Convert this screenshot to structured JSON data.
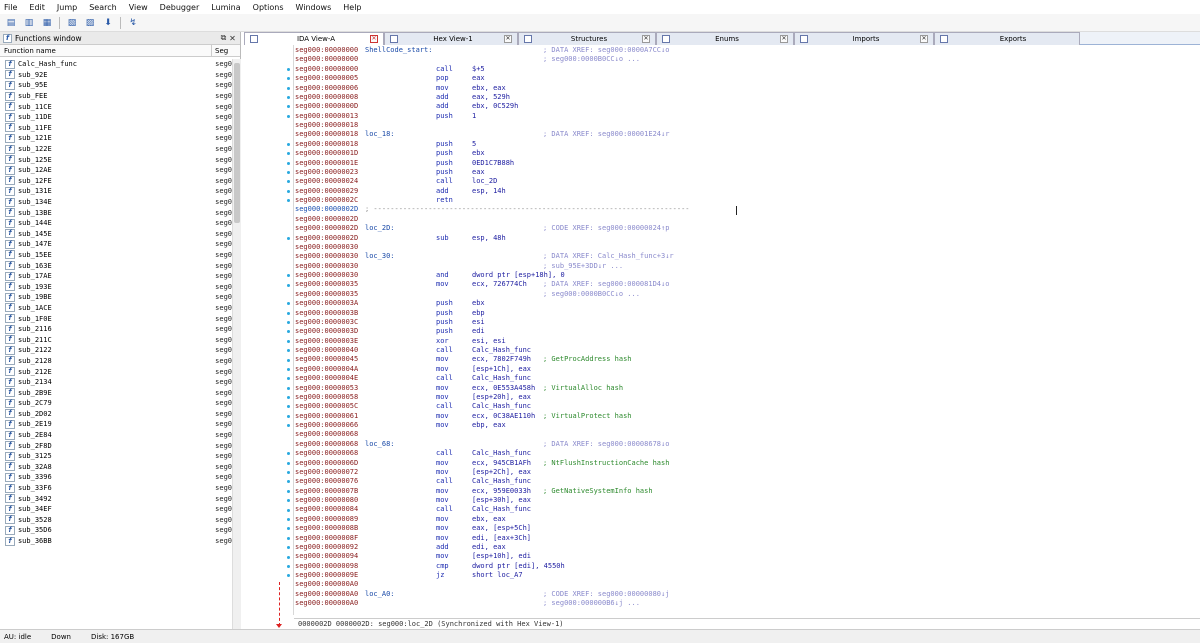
{
  "menu": [
    "File",
    "Edit",
    "Jump",
    "Search",
    "View",
    "Debugger",
    "Lumina",
    "Options",
    "Windows",
    "Help"
  ],
  "functions_window": {
    "title": "Functions window",
    "col_name": "Function name",
    "col_seg": "Seg",
    "functions": [
      "Calc_Hash_func",
      "sub_92E",
      "sub_95E",
      "sub_FEE",
      "sub_11CE",
      "sub_11DE",
      "sub_11FE",
      "sub_121E",
      "sub_122E",
      "sub_125E",
      "sub_12AE",
      "sub_12FE",
      "sub_131E",
      "sub_134E",
      "sub_13BE",
      "sub_144E",
      "sub_145E",
      "sub_147E",
      "sub_15EE",
      "sub_163E",
      "sub_17AE",
      "sub_193E",
      "sub_19BE",
      "sub_1ACE",
      "sub_1F0E",
      "sub_2116",
      "sub_211C",
      "sub_2122",
      "sub_2128",
      "sub_212E",
      "sub_2134",
      "sub_2B9E",
      "sub_2C79",
      "sub_2D02",
      "sub_2E19",
      "sub_2E84",
      "sub_2F8D",
      "sub_3125",
      "sub_32A8",
      "sub_3396",
      "sub_33F6",
      "sub_3492",
      "sub_34EF",
      "sub_3528",
      "sub_35D6",
      "sub_36BB"
    ],
    "seg_value": "seg0"
  },
  "tabs": [
    {
      "label": "IDA View-A",
      "active": true
    },
    {
      "label": "Hex View-1",
      "active": false
    },
    {
      "label": "Structures",
      "active": false
    },
    {
      "label": "Enums",
      "active": false
    },
    {
      "label": "Imports",
      "active": false
    },
    {
      "label": "Exports",
      "active": false
    }
  ],
  "disasm": [
    {
      "a": "seg000:00000000",
      "l": "ShellCode_start:",
      "x": "; DATA XREF: seg000:0000A7CC↓o"
    },
    {
      "a": "seg000:00000000",
      "x": "; seg000:0000B0CC↓o ..."
    },
    {
      "a": "seg000:00000000",
      "m": "call",
      "o": "$+5",
      "d": 1
    },
    {
      "a": "seg000:00000005",
      "m": "pop",
      "o": "eax",
      "d": 1
    },
    {
      "a": "seg000:00000006",
      "m": "mov",
      "o": "ebx, eax",
      "d": 1
    },
    {
      "a": "seg000:00000008",
      "m": "add",
      "o": "eax, 529h",
      "d": 1
    },
    {
      "a": "seg000:0000000D",
      "m": "add",
      "o": "ebx, 0C529h",
      "d": 1
    },
    {
      "a": "seg000:00000013",
      "m": "push",
      "o": "1",
      "d": 1
    },
    {
      "a": "seg000:00000018"
    },
    {
      "a": "seg000:00000018",
      "l": "loc_18:",
      "x": "; DATA XREF: seg000:00001E24↓r"
    },
    {
      "a": "seg000:00000018",
      "m": "push",
      "o": "5",
      "d": 1
    },
    {
      "a": "seg000:0000001D",
      "m": "push",
      "o": "ebx",
      "d": 1
    },
    {
      "a": "seg000:0000001E",
      "m": "push",
      "o": "0ED1C7B88h",
      "d": 1
    },
    {
      "a": "seg000:00000023",
      "m": "push",
      "o": "eax",
      "d": 1
    },
    {
      "a": "seg000:00000024",
      "m": "call",
      "o": "loc_2D",
      "d": 1
    },
    {
      "a": "seg000:00000029",
      "m": "add",
      "o": "esp, 14h",
      "d": 1
    },
    {
      "a": "seg000:0000002C",
      "m": "retn",
      "d": 1
    },
    {
      "a": "seg000:0000002D",
      "sep": "; ---------------------------------------------------------------------------",
      "hl": 1
    },
    {
      "a": "seg000:0000002D"
    },
    {
      "a": "seg000:0000002D",
      "l": "loc_2D:",
      "x": "; CODE XREF: seg000:00000024↑p"
    },
    {
      "a": "seg000:0000002D",
      "m": "sub",
      "o": "esp, 48h",
      "d": 1
    },
    {
      "a": "seg000:00000030"
    },
    {
      "a": "seg000:00000030",
      "l": "loc_30:",
      "x": "; DATA XREF: Calc_Hash_func+3↓r"
    },
    {
      "a": "seg000:00000030",
      "x": "; sub_95E+3DD↓r ..."
    },
    {
      "a": "seg000:00000030",
      "m": "and",
      "o": "dword ptr [esp+18h], 0",
      "d": 1
    },
    {
      "a": "seg000:00000035",
      "m": "mov",
      "o": "ecx, 726774Ch",
      "x": "; DATA XREF: seg000:000081D4↓o",
      "d": 1
    },
    {
      "a": "seg000:00000035",
      "x": "; seg000:0000B0CC↓o ..."
    },
    {
      "a": "seg000:0000003A",
      "m": "push",
      "o": "ebx",
      "d": 1
    },
    {
      "a": "seg000:0000003B",
      "m": "push",
      "o": "ebp",
      "d": 1
    },
    {
      "a": "seg000:0000003C",
      "m": "push",
      "o": "esi",
      "d": 1
    },
    {
      "a": "seg000:0000003D",
      "m": "push",
      "o": "edi",
      "d": 1
    },
    {
      "a": "seg000:0000003E",
      "m": "xor",
      "o": "esi, esi",
      "d": 1
    },
    {
      "a": "seg000:00000040",
      "m": "call",
      "o": "Calc_Hash_func",
      "d": 1
    },
    {
      "a": "seg000:00000045",
      "m": "mov",
      "o": "ecx, 7802F749h",
      "c": "; GetProcAddress hash",
      "d": 1
    },
    {
      "a": "seg000:0000004A",
      "m": "mov",
      "o": "[esp+1Ch], eax",
      "d": 1
    },
    {
      "a": "seg000:0000004E",
      "m": "call",
      "o": "Calc_Hash_func",
      "d": 1
    },
    {
      "a": "seg000:00000053",
      "m": "mov",
      "o": "ecx, 0E553A458h",
      "c": "; VirtualAlloc hash",
      "d": 1
    },
    {
      "a": "seg000:00000058",
      "m": "mov",
      "o": "[esp+20h], eax",
      "d": 1
    },
    {
      "a": "seg000:0000005C",
      "m": "call",
      "o": "Calc_Hash_func",
      "d": 1
    },
    {
      "a": "seg000:00000061",
      "m": "mov",
      "o": "ecx, 0C38AE110h",
      "c": "; VirtualProtect hash",
      "d": 1
    },
    {
      "a": "seg000:00000066",
      "m": "mov",
      "o": "ebp, eax",
      "d": 1
    },
    {
      "a": "seg000:00000068"
    },
    {
      "a": "seg000:00000068",
      "l": "loc_68:",
      "x": "; DATA XREF: seg000:00008678↓o"
    },
    {
      "a": "seg000:00000068",
      "m": "call",
      "o": "Calc_Hash_func",
      "d": 1
    },
    {
      "a": "seg000:0000006D",
      "m": "mov",
      "o": "ecx, 945CB1AFh",
      "c": "; NtFlushInstructionCache hash",
      "d": 1
    },
    {
      "a": "seg000:00000072",
      "m": "mov",
      "o": "[esp+2Ch], eax",
      "d": 1
    },
    {
      "a": "seg000:00000076",
      "m": "call",
      "o": "Calc_Hash_func",
      "d": 1
    },
    {
      "a": "seg000:0000007B",
      "m": "mov",
      "o": "ecx, 959E0033h",
      "c": "; GetNativeSystemInfo hash",
      "d": 1
    },
    {
      "a": "seg000:00000080",
      "m": "mov",
      "o": "[esp+30h], eax",
      "d": 1
    },
    {
      "a": "seg000:00000084",
      "m": "call",
      "o": "Calc_Hash_func",
      "d": 1
    },
    {
      "a": "seg000:00000089",
      "m": "mov",
      "o": "ebx, eax",
      "d": 1
    },
    {
      "a": "seg000:0000008B",
      "m": "mov",
      "o": "eax, [esp+5Ch]",
      "d": 1
    },
    {
      "a": "seg000:0000008F",
      "m": "mov",
      "o": "edi, [eax+3Ch]",
      "d": 1
    },
    {
      "a": "seg000:00000092",
      "m": "add",
      "o": "edi, eax",
      "d": 1
    },
    {
      "a": "seg000:00000094",
      "m": "mov",
      "o": "[esp+10h], edi",
      "d": 1
    },
    {
      "a": "seg000:00000098",
      "m": "cmp",
      "o": "dword ptr [edi], 4550h",
      "d": 1
    },
    {
      "a": "seg000:0000009E",
      "m": "jz",
      "o": "short loc_A7",
      "d": 1
    },
    {
      "a": "seg000:000000A0"
    },
    {
      "a": "seg000:000000A0",
      "l": "loc_A0:",
      "x": "; CODE XREF: seg000:00000080↓j"
    },
    {
      "a": "seg000:000000A0",
      "x": "; seg000:000000B6↓j ..."
    }
  ],
  "sync_text": "0000002D 0000002D: seg000:loc_2D (Synchronized with Hex View-1)",
  "status": {
    "au": "AU:  idle",
    "dir": "Down",
    "disk": "Disk: 167GB"
  }
}
